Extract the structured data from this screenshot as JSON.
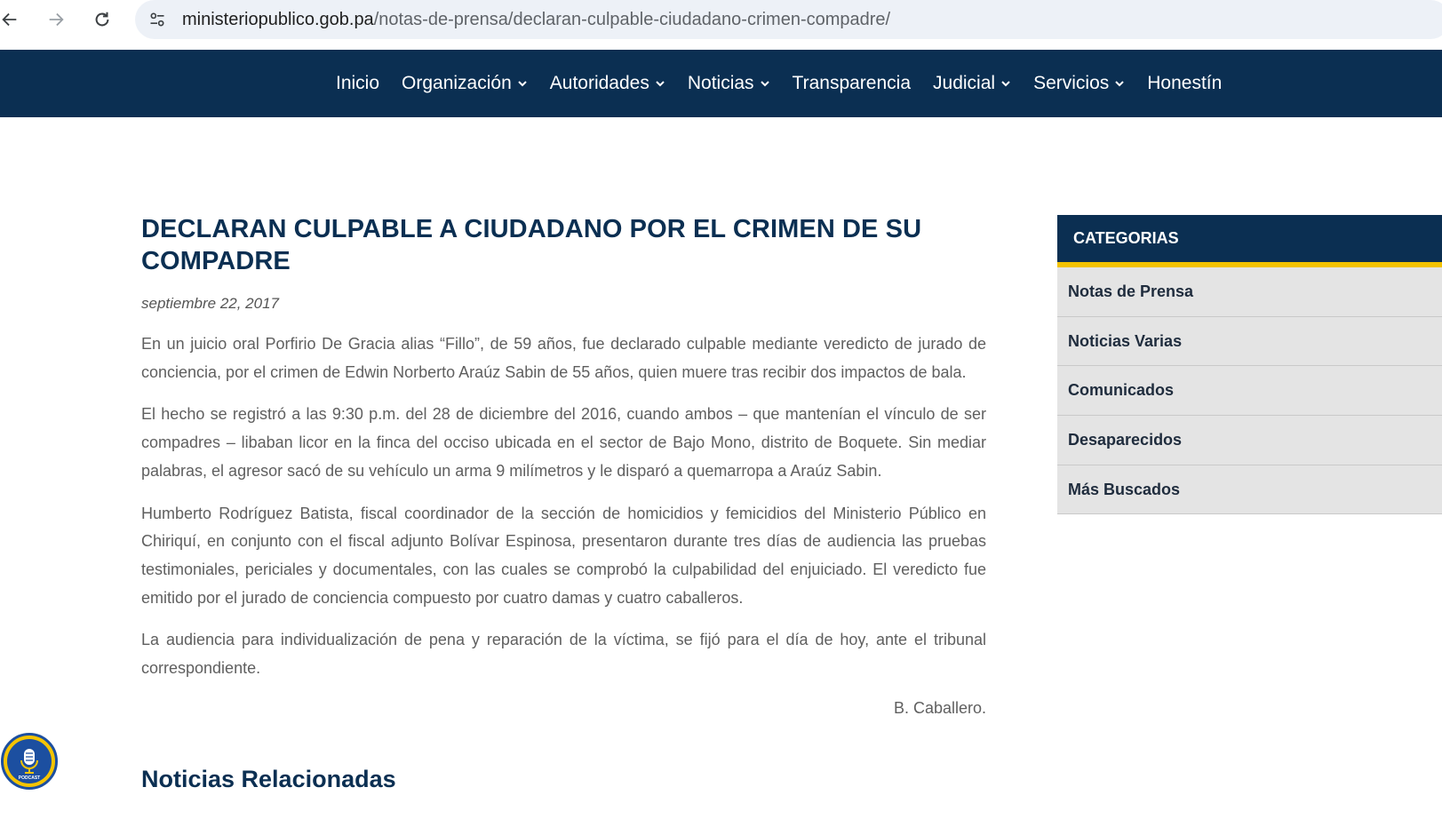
{
  "browser": {
    "url_domain": "ministeriopublico.gob.pa",
    "url_path": "/notas-de-prensa/declaran-culpable-ciudadano-crimen-compadre/"
  },
  "nav": {
    "items": [
      {
        "label": "Inicio",
        "has_dropdown": false
      },
      {
        "label": "Organización",
        "has_dropdown": true
      },
      {
        "label": "Autoridades",
        "has_dropdown": true
      },
      {
        "label": "Noticias",
        "has_dropdown": true
      },
      {
        "label": "Transparencia",
        "has_dropdown": false
      },
      {
        "label": "Judicial",
        "has_dropdown": true
      },
      {
        "label": "Servicios",
        "has_dropdown": true
      },
      {
        "label": "Honestín",
        "has_dropdown": false
      }
    ]
  },
  "article": {
    "title_line1": "DECLARAN CULPABLE A CIUDADANO POR EL CRIMEN DE SU",
    "title_line2": "COMPADRE",
    "date": "septiembre 22, 2017",
    "paragraphs": [
      "En un juicio oral Porfirio De Gracia alias “Fillo”, de 59 años, fue declarado culpable mediante veredicto de jurado de conciencia, por el crimen de Edwin Norberto Araúz Sabin de 55 años, quien muere tras recibir dos impactos de bala.",
      "El hecho se registró a las 9:30 p.m. del 28 de diciembre del 2016, cuando ambos – que mantenían el vínculo de ser compadres – libaban licor en la finca del occiso ubicada en el sector de Bajo Mono, distrito de Boquete. Sin mediar palabras, el agresor sacó de su vehículo un arma 9 milímetros y le disparó a quemarropa a Araúz Sabin.",
      "Humberto Rodríguez Batista, fiscal coordinador de la sección de homicidios y femicidios del Ministerio Público en Chiriquí, en conjunto con el fiscal adjunto Bolívar Espinosa, presentaron durante tres días de audiencia las pruebas testimoniales, periciales y documentales, con las cuales se comprobó la culpabilidad del enjuiciado. El veredicto fue emitido por el jurado de conciencia compuesto por cuatro damas y cuatro caballeros.",
      "La audiencia para individualización de pena y reparación de la víctima, se fijó para el día de hoy, ante el tribunal correspondiente."
    ],
    "signature": "B. Caballero.",
    "related_title": "Noticias Relacionadas"
  },
  "sidebar": {
    "header": "CATEGORIAS",
    "categories": [
      "Notas de Prensa",
      "Noticias Varias",
      "Comunicados",
      "Desaparecidos",
      "Más Buscados"
    ]
  },
  "badge": {
    "label": "PODCAST"
  },
  "colors": {
    "navy": "#0b2f52",
    "accent_yellow": "#f2c200",
    "sidebar_bg": "#e4e4e4",
    "body_text": "#5f5f5f"
  }
}
